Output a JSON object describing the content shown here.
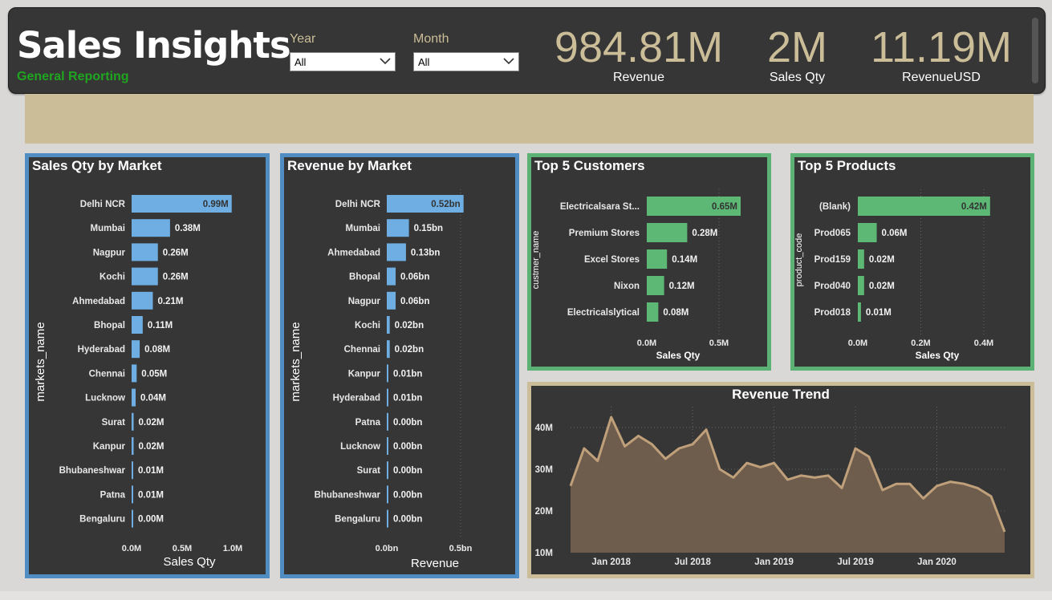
{
  "header": {
    "title": "Sales Insights",
    "subtitle": "General Reporting"
  },
  "filters": {
    "year": {
      "label": "Year",
      "value": "All"
    },
    "month": {
      "label": "Month",
      "value": "All"
    }
  },
  "kpis": {
    "revenue": {
      "value": "984.81M",
      "label": "Revenue"
    },
    "sales_qty": {
      "value": "2M",
      "label": "Sales Qty"
    },
    "revenue_usd": {
      "value": "11.19M",
      "label": "RevenueUSD"
    }
  },
  "colors": {
    "market_bar": "#6eaee3",
    "top5_bar": "#5cb874",
    "trend_line": "#bfa07a",
    "trend_fill": "#6e5d4d",
    "green_text": "#1fa51f",
    "tan": "#cbbd98"
  },
  "icons": [
    "chevron-down-icon"
  ],
  "chart_data": [
    {
      "id": "sales_qty_by_market",
      "type": "bar",
      "orientation": "horizontal",
      "title": "Sales Qty by Market",
      "xlabel": "Sales Qty",
      "ylabel": "markets_name",
      "categories": [
        "Delhi NCR",
        "Mumbai",
        "Nagpur",
        "Kochi",
        "Ahmedabad",
        "Bhopal",
        "Hyderabad",
        "Chennai",
        "Lucknow",
        "Surat",
        "Kanpur",
        "Bhubaneshwar",
        "Patna",
        "Bengaluru"
      ],
      "values": [
        0.99,
        0.38,
        0.26,
        0.26,
        0.21,
        0.11,
        0.08,
        0.05,
        0.04,
        0.02,
        0.02,
        0.01,
        0.01,
        0.0
      ],
      "value_labels": [
        "0.99M",
        "0.38M",
        "0.26M",
        "0.26M",
        "0.21M",
        "0.11M",
        "0.08M",
        "0.05M",
        "0.04M",
        "0.02M",
        "0.02M",
        "0.01M",
        "0.01M",
        "0.00M"
      ],
      "xlim": [
        0,
        1.0
      ],
      "x_ticks": [
        0,
        0.5,
        1.0
      ],
      "x_tick_labels": [
        "0.0M",
        "0.5M",
        "1.0M"
      ],
      "grid": false
    },
    {
      "id": "revenue_by_market",
      "type": "bar",
      "orientation": "horizontal",
      "title": "Revenue by Market",
      "xlabel": "Revenue",
      "ylabel": "markets_name",
      "categories": [
        "Delhi NCR",
        "Mumbai",
        "Ahmedabad",
        "Bhopal",
        "Nagpur",
        "Kochi",
        "Chennai",
        "Kanpur",
        "Hyderabad",
        "Patna",
        "Lucknow",
        "Surat",
        "Bhubaneshwar",
        "Bengaluru"
      ],
      "values": [
        0.52,
        0.15,
        0.13,
        0.06,
        0.06,
        0.02,
        0.02,
        0.01,
        0.01,
        0.0,
        0.0,
        0.0,
        0.0,
        0.0
      ],
      "value_labels": [
        "0.52bn",
        "0.15bn",
        "0.13bn",
        "0.06bn",
        "0.06bn",
        "0.02bn",
        "0.02bn",
        "0.01bn",
        "0.01bn",
        "0.00bn",
        "0.00bn",
        "0.00bn",
        "0.00bn",
        "0.00bn"
      ],
      "xlim": [
        0,
        0.5
      ],
      "x_ticks": [
        0,
        0.5
      ],
      "x_tick_labels": [
        "0.0bn",
        "0.5bn"
      ],
      "grid": true
    },
    {
      "id": "top5_customers",
      "type": "bar",
      "orientation": "horizontal",
      "title": "Top 5 Customers",
      "xlabel": "Sales Qty",
      "ylabel": "custmer_name",
      "categories": [
        "Electricalsara St...",
        "Premium Stores",
        "Excel Stores",
        "Nixon",
        "Electricalslytical"
      ],
      "values": [
        0.65,
        0.28,
        0.14,
        0.12,
        0.08
      ],
      "value_labels": [
        "0.65M",
        "0.28M",
        "0.14M",
        "0.12M",
        "0.08M"
      ],
      "xlim": [
        0,
        0.5
      ],
      "x_ticks": [
        0,
        0.5
      ],
      "x_tick_labels": [
        "0.0M",
        "0.5M"
      ],
      "grid": true
    },
    {
      "id": "top5_products",
      "type": "bar",
      "orientation": "horizontal",
      "title": "Top 5 Products",
      "xlabel": "Sales Qty",
      "ylabel": "product_code",
      "categories": [
        "(Blank)",
        "Prod065",
        "Prod159",
        "Prod040",
        "Prod018"
      ],
      "values": [
        0.42,
        0.06,
        0.02,
        0.02,
        0.01
      ],
      "value_labels": [
        "0.42M",
        "0.06M",
        "0.02M",
        "0.02M",
        "0.01M"
      ],
      "xlim": [
        0,
        0.4
      ],
      "x_ticks": [
        0,
        0.2,
        0.4
      ],
      "x_tick_labels": [
        "0.0M",
        "0.2M",
        "0.4M"
      ],
      "grid": true
    },
    {
      "id": "revenue_trend",
      "type": "area",
      "title": "Revenue Trend",
      "xlabel": "",
      "ylabel": "",
      "x": [
        "2017-10",
        "2017-11",
        "2017-12",
        "2018-01",
        "2018-02",
        "2018-03",
        "2018-04",
        "2018-05",
        "2018-06",
        "2018-07",
        "2018-08",
        "2018-09",
        "2018-10",
        "2018-11",
        "2018-12",
        "2019-01",
        "2019-02",
        "2019-03",
        "2019-04",
        "2019-05",
        "2019-06",
        "2019-07",
        "2019-08",
        "2019-09",
        "2019-10",
        "2019-11",
        "2019-12",
        "2020-01",
        "2020-02",
        "2020-03",
        "2020-04",
        "2020-05",
        "2020-06"
      ],
      "values": [
        26.0,
        35.0,
        32.0,
        42.5,
        35.5,
        38.0,
        36.0,
        32.5,
        35.0,
        36.0,
        39.5,
        30.0,
        28.0,
        31.5,
        30.5,
        31.5,
        27.5,
        28.5,
        28.0,
        28.5,
        25.5,
        35.0,
        33.0,
        25.0,
        26.5,
        26.5,
        23.0,
        26.0,
        27.0,
        26.5,
        25.5,
        23.5,
        15.0
      ],
      "ylim": [
        10,
        45
      ],
      "y_ticks": [
        10,
        20,
        30,
        40
      ],
      "y_tick_labels": [
        "10M",
        "20M",
        "30M",
        "40M"
      ],
      "x_ticks": [
        "2018-01",
        "2018-07",
        "2019-01",
        "2019-07",
        "2020-01"
      ],
      "x_tick_labels": [
        "Jan 2018",
        "Jul 2018",
        "Jan 2019",
        "Jul 2019",
        "Jan 2020"
      ],
      "grid": true
    }
  ]
}
